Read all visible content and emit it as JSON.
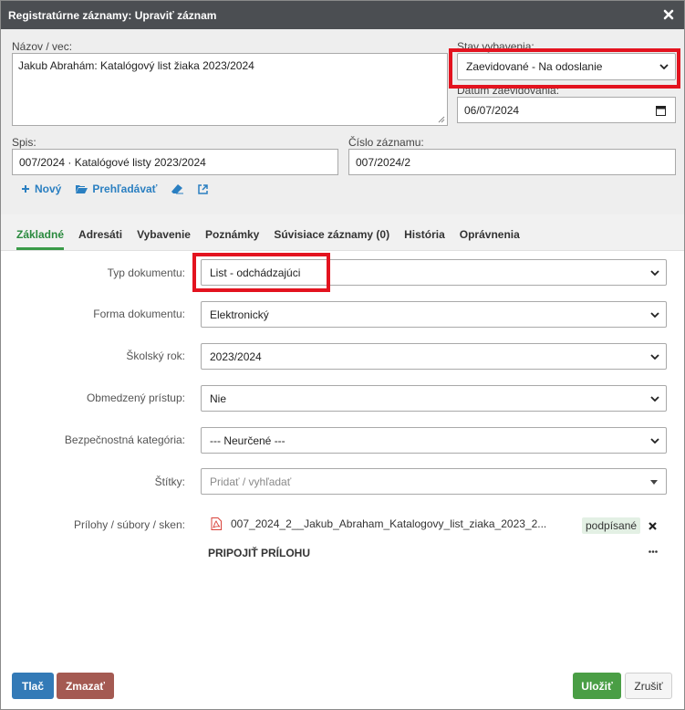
{
  "window": {
    "title": "Registratúrne záznamy: Upraviť záznam"
  },
  "top": {
    "name_label": "Názov / vec:",
    "name_value": "Jakub Abrahám: Katalógový list žiaka 2023/2024",
    "status_label": "Stav vybavenia:",
    "status_value": "Zaevidované - Na odoslanie",
    "date_label": "Dátum zaevidovania:",
    "date_value": "06/07/2024",
    "spis_label": "Spis:",
    "spis_value": "007/2024 · Katalógové listy 2023/2024",
    "cislo_label": "Číslo záznamu:",
    "cislo_value": "007/2024/2",
    "links": {
      "new": "Nový",
      "browse": "Prehľadávať"
    }
  },
  "tabs": [
    {
      "label": "Základné"
    },
    {
      "label": "Adresáti"
    },
    {
      "label": "Vybavenie"
    },
    {
      "label": "Poznámky"
    },
    {
      "label": "Súvisiace záznamy (0)"
    },
    {
      "label": "História"
    },
    {
      "label": "Oprávnenia"
    }
  ],
  "form": {
    "typ_label": "Typ dokumentu:",
    "typ_value": "List - odchádzajúci",
    "forma_label": "Forma dokumentu:",
    "forma_value": "Elektronický",
    "rok_label": "Školský rok:",
    "rok_value": "2023/2024",
    "pristup_label": "Obmedzený prístup:",
    "pristup_value": "Nie",
    "kategoria_label": "Bezpečnostná kategória:",
    "kategoria_value": "--- Neurčené ---",
    "stitky_label": "Štítky:",
    "stitky_placeholder": "Pridať / vyhľadať",
    "prilohy_label": "Prílohy / súbory / sken:",
    "file_name": "007_2024_2__Jakub_Abraham_Katalogovy_list_ziaka_2023_2...",
    "file_badge": "podpísané",
    "attach_label": "PRIPOJIŤ PRÍLOHU"
  },
  "buttons": {
    "print": "Tlač",
    "delete": "Zmazať",
    "save": "Uložiť",
    "cancel": "Zrušiť"
  },
  "colors": {
    "titlebar": "#4b4e52",
    "highlight": "#e3131f",
    "tab_active": "#2a8a3e",
    "link": "#2a7fc1",
    "print_btn": "#337ab7",
    "delete_btn": "#a45a52",
    "save_btn": "#4a9e45"
  }
}
